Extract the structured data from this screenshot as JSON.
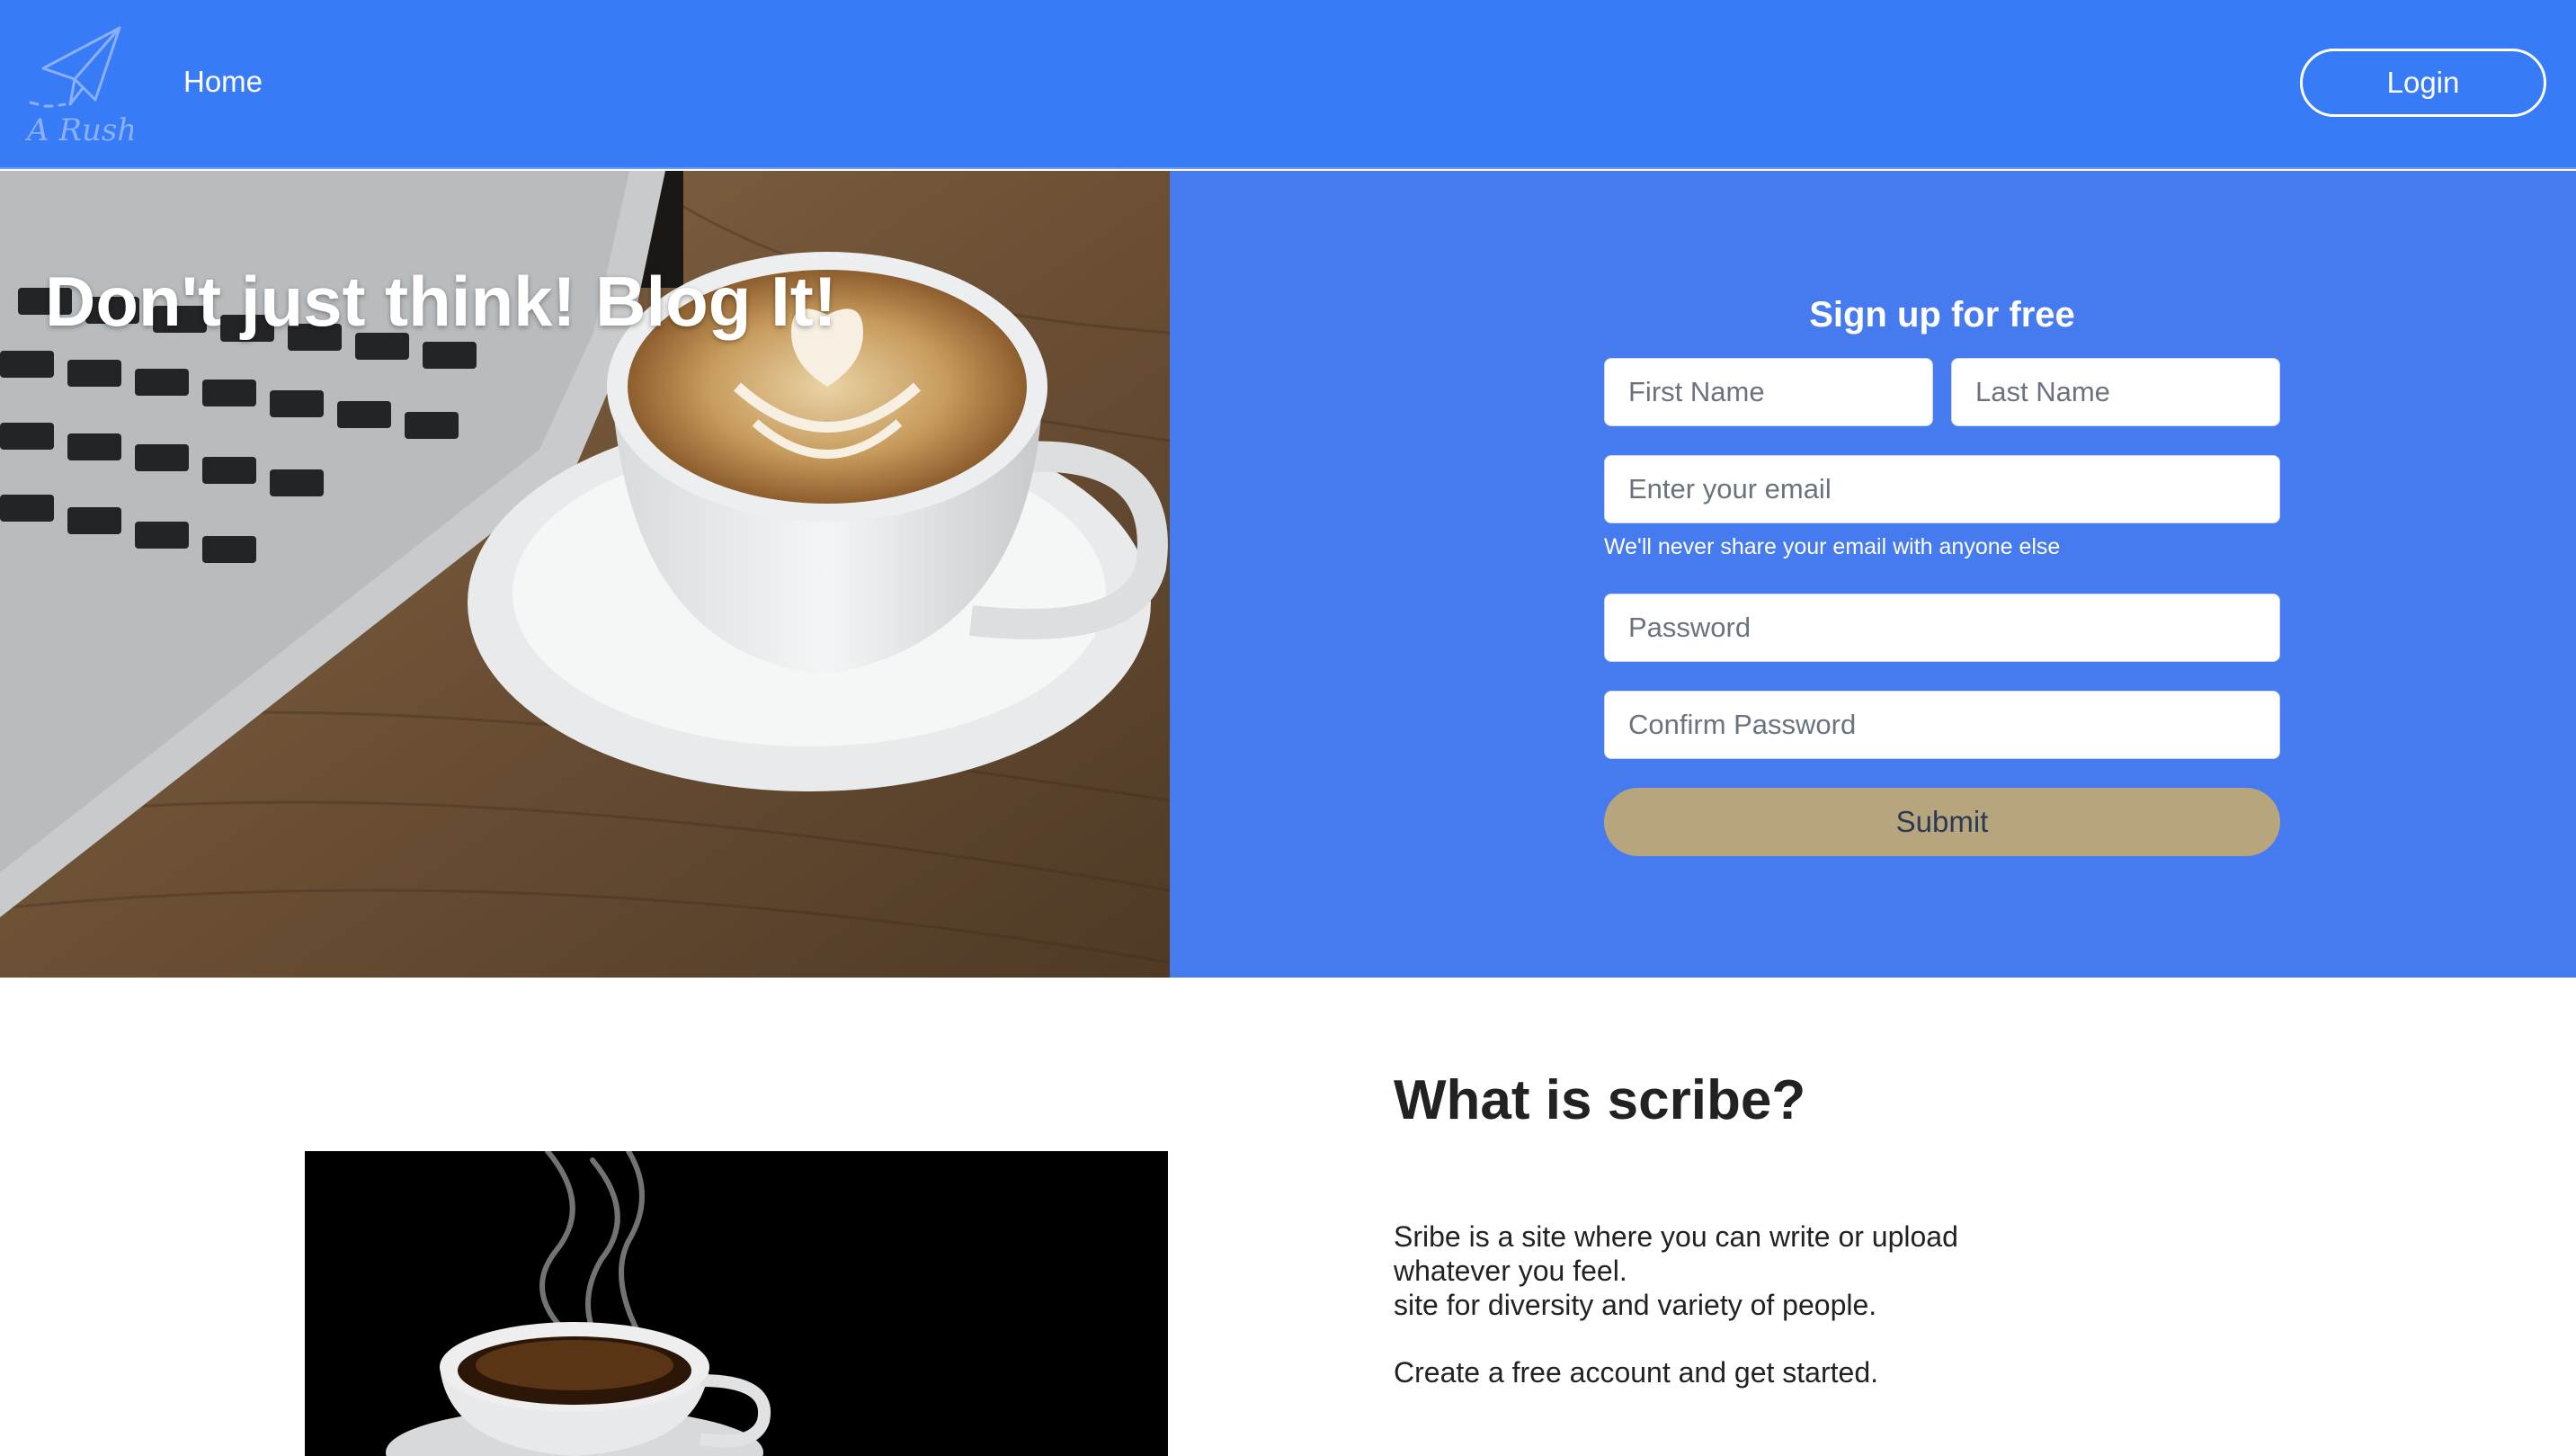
{
  "navbar": {
    "logo_text": "A Rush",
    "home_label": "Home",
    "login_label": "Login"
  },
  "hero": {
    "title": "Don't just think! Blog It!"
  },
  "signup": {
    "title": "Sign up for free",
    "first_name_placeholder": "First Name",
    "last_name_placeholder": "Last Name",
    "email_placeholder": "Enter your email",
    "email_hint": "We'll never share your email with anyone else",
    "password_placeholder": "Password",
    "confirm_password_placeholder": "Confirm Password",
    "submit_label": "Submit"
  },
  "about": {
    "title": "What is scribe?",
    "line1": "Sribe is a site where you can write or upload whatever you feel.",
    "line2": "site for diversity and variety of people.",
    "cta": "Create a free account and get started."
  },
  "colors": {
    "navbar": "#387bf7",
    "signup_panel": "#467bef",
    "submit_button": "#b7a67d",
    "text_dark": "#222222"
  },
  "icons": {
    "logo": "paper-plane-icon"
  }
}
